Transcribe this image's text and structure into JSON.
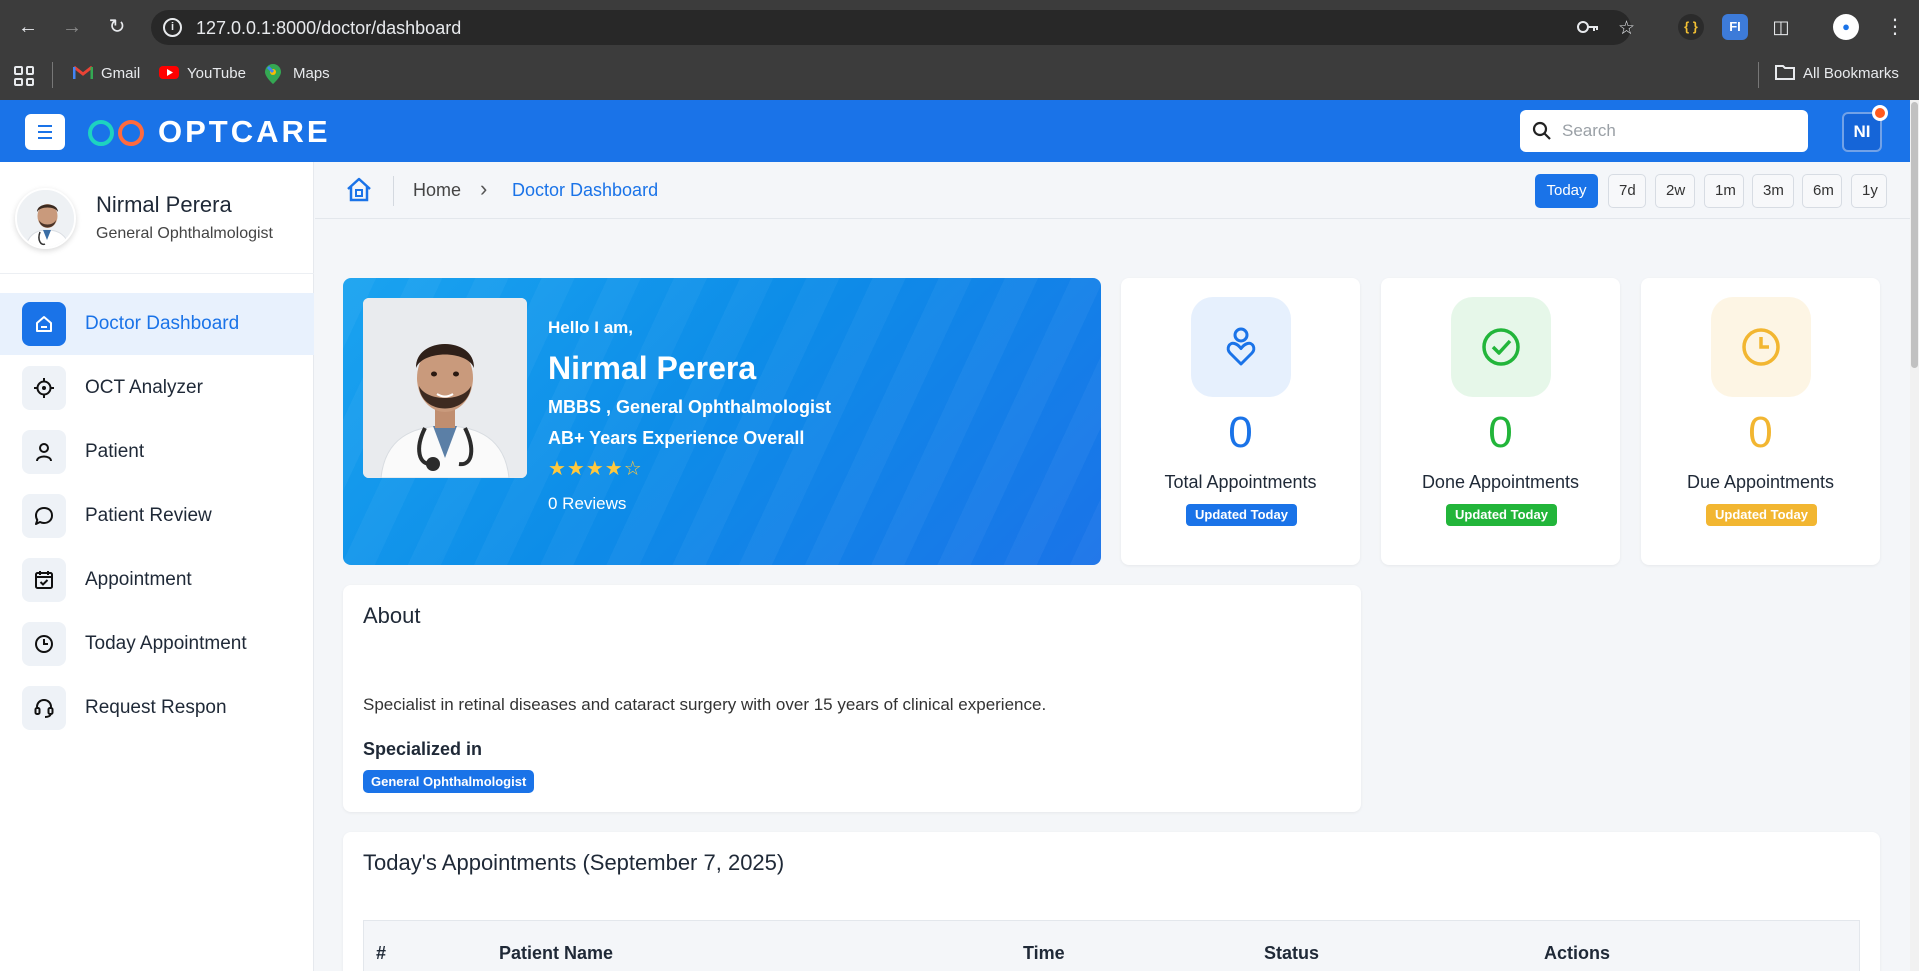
{
  "browser": {
    "url": "127.0.0.1:8000/doctor/dashboard",
    "bookmarks": [
      {
        "label": "Gmail",
        "icon": "gmail-icon"
      },
      {
        "label": "YouTube",
        "icon": "youtube-icon"
      },
      {
        "label": "Maps",
        "icon": "maps-icon"
      }
    ],
    "all_bookmarks": "All Bookmarks"
  },
  "header": {
    "brand": "OPTCARE",
    "search_placeholder": "Search",
    "user_initials": "NI",
    "accent": "#1a73e8"
  },
  "sidebar": {
    "name": "Nirmal Perera",
    "role": "General Ophthalmologist",
    "items": [
      {
        "label": "Doctor Dashboard",
        "icon": "home-icon",
        "active": true
      },
      {
        "label": "OCT Analyzer",
        "icon": "crosshair-icon",
        "active": false
      },
      {
        "label": "Patient",
        "icon": "user-icon",
        "active": false
      },
      {
        "label": "Patient Review",
        "icon": "chat-bubble-icon",
        "active": false
      },
      {
        "label": "Appointment",
        "icon": "calendar-check-icon",
        "active": false
      },
      {
        "label": "Today Appointment",
        "icon": "clock-icon",
        "active": false
      },
      {
        "label": "Request Respon",
        "icon": "headset-icon",
        "active": false
      }
    ]
  },
  "breadcrumb": {
    "home": "Home",
    "current": "Doctor Dashboard"
  },
  "ranges": [
    "Today",
    "7d",
    "2w",
    "1m",
    "3m",
    "6m",
    "1y"
  ],
  "active_range": "Today",
  "hero": {
    "greeting": "Hello I am,",
    "name": "Nirmal Perera",
    "qualifications": "MBBS , General Ophthalmologist",
    "experience": "AB+ Years Experience Overall",
    "rating": 4,
    "rating_max": 5,
    "reviews": "0 Reviews"
  },
  "stats": [
    {
      "value": "0",
      "label": "Total Appointments",
      "badge": "Updated Today",
      "color": "#1a73e8",
      "bg": "#e6f0fd",
      "icon": "person-heart-icon"
    },
    {
      "value": "0",
      "label": "Done Appointments",
      "badge": "Updated Today",
      "color": "#22b53a",
      "bg": "#e6f7e9",
      "icon": "check-circle-icon"
    },
    {
      "value": "0",
      "label": "Due Appointments",
      "badge": "Updated Today",
      "color": "#f2b631",
      "bg": "#fdf5e4",
      "icon": "clock-icon"
    }
  ],
  "about": {
    "title": "About",
    "text": "Specialist in retinal diseases and cataract surgery with over 15 years of clinical experience.",
    "specialized_title": "Specialized in",
    "specialization": "General Ophthalmologist"
  },
  "appointments": {
    "title": "Today's Appointments (September 7, 2025)",
    "columns": [
      "#",
      "Patient Name",
      "Time",
      "Status",
      "Actions"
    ]
  }
}
